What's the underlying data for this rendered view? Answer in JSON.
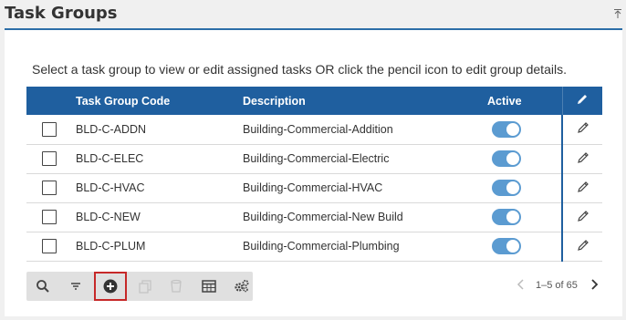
{
  "header": {
    "title": "Task Groups"
  },
  "instructions": "Select a task group to view or edit assigned tasks OR click the pencil icon to edit group details.",
  "table": {
    "columns": {
      "code": "Task Group Code",
      "description": "Description",
      "active": "Active"
    },
    "rows": [
      {
        "code": "BLD-C-ADDN",
        "description": "Building-Commercial-Addition",
        "active": true
      },
      {
        "code": "BLD-C-ELEC",
        "description": "Building-Commercial-Electric",
        "active": true
      },
      {
        "code": "BLD-C-HVAC",
        "description": "Building-Commercial-HVAC",
        "active": true
      },
      {
        "code": "BLD-C-NEW",
        "description": "Building-Commercial-New Build",
        "active": true
      },
      {
        "code": "BLD-C-PLUM",
        "description": "Building-Commercial-Plumbing",
        "active": true
      }
    ]
  },
  "toolbar": {
    "icons": [
      "search-icon",
      "filter-icon",
      "add-circle-icon",
      "copy-icon",
      "delete-icon",
      "columns-icon",
      "settings-icon"
    ],
    "highlighted": "add-circle-icon"
  },
  "pager": {
    "range": "1–5 of 65"
  },
  "colors": {
    "header_bg": "#1f5f9f",
    "toggle_on": "#5b9bd1",
    "highlight_border": "#c62828"
  }
}
